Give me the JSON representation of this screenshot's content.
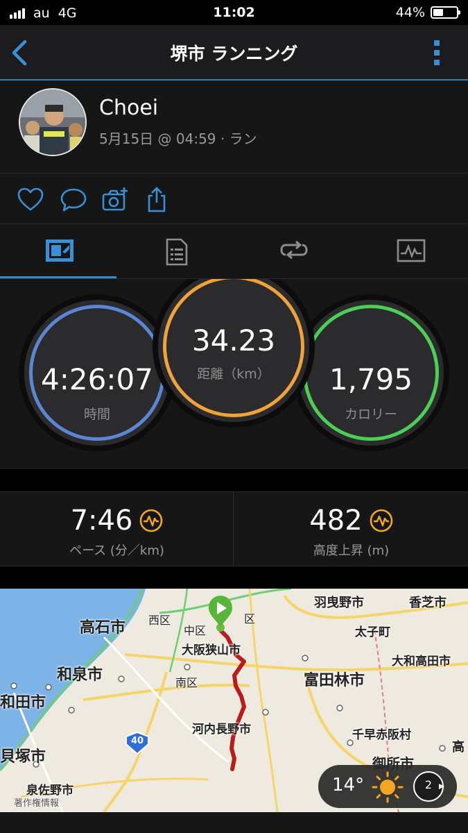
{
  "status": {
    "carrier": "au",
    "network": "4G",
    "time": "11:02",
    "battery": "44%",
    "battery_level": 0.44
  },
  "nav": {
    "title": "堺市 ランニング",
    "back_icon": "chevron-left-icon",
    "menu_icon": "vertical-dots-icon",
    "accent": "#3a8fd6"
  },
  "profile": {
    "name": "Choei",
    "meta": "5月15日 @ 04:59 · ラン"
  },
  "actions": [
    "heart-icon",
    "comment-icon",
    "camera-add-icon",
    "share-icon"
  ],
  "tabs": [
    "overview-icon",
    "details-icon",
    "laps-icon",
    "chart-icon"
  ],
  "stats": {
    "time": {
      "value": "4:26:07",
      "label": "時間"
    },
    "distance": {
      "value": "34.23",
      "label": "距離（km）"
    },
    "calories": {
      "value": "1,795",
      "label": "カロリー"
    }
  },
  "metrics": {
    "pace": {
      "value": "7:46",
      "label": "ペース (分／km)"
    },
    "elevation": {
      "value": "482",
      "label": "高度上昇 (m)"
    }
  },
  "map": {
    "labels": [
      "羽曳野市",
      "香芝市",
      "高石市",
      "西区",
      "区",
      "中区",
      "太子町",
      "大阪狭山市",
      "大和高田市",
      "和泉市",
      "富田林市",
      "南区",
      "和田市",
      "河内長野市",
      "千早赤阪村",
      "貝塚市",
      "御所市",
      "高",
      "泉佐野市",
      "著作権情報"
    ],
    "route_sign": "40"
  },
  "weather": {
    "temp": "14°",
    "wind": "2"
  }
}
